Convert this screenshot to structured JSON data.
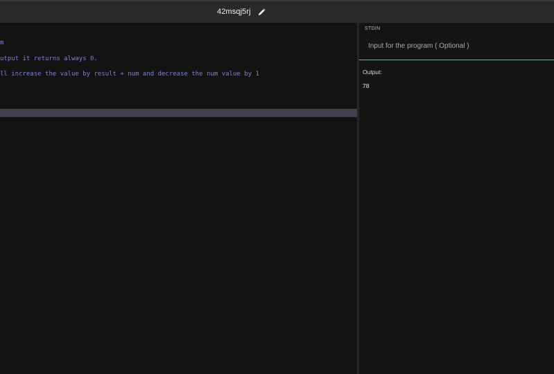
{
  "header": {
    "title": "42msqj5rj",
    "edit_icon": "pencil-icon"
  },
  "editor": {
    "lines": [
      "m",
      "utput it returns always 0.",
      "ll increase the value by result + num and decrease the num value by 1"
    ]
  },
  "stdin": {
    "label": "STDIN",
    "placeholder": "Input for the program ( Optional )"
  },
  "output": {
    "label": "Output:",
    "value": "78"
  },
  "colors": {
    "background": "#151515",
    "topbar": "#2a2a2d",
    "comment_text": "#7f84c9",
    "current_line": "#41414d",
    "stdin_border": "#8aa890"
  }
}
